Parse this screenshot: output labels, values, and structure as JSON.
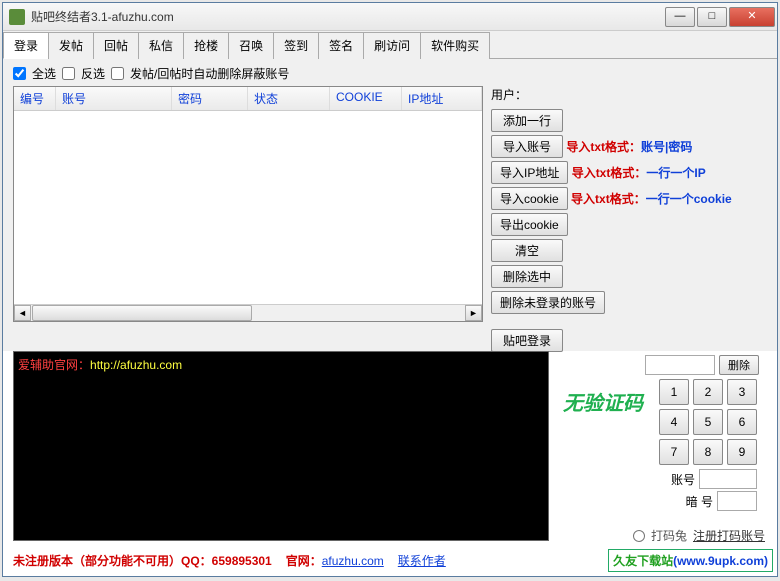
{
  "window": {
    "title": "贴吧终结者3.1-afuzhu.com",
    "min": "—",
    "max": "□",
    "close": "✕"
  },
  "tabs": [
    "登录",
    "发帖",
    "回帖",
    "私信",
    "抢楼",
    "召唤",
    "签到",
    "签名",
    "刷访问",
    "软件购买"
  ],
  "checkboxes": {
    "select_all": "全选",
    "invert": "反选",
    "auto_delete": "发帖/回帖时自动删除屏蔽账号"
  },
  "table": {
    "headers": [
      "编号",
      "账号",
      "密码",
      "状态",
      "COOKIE",
      "IP地址"
    ]
  },
  "side": {
    "user_label": "用户：",
    "add_row": "添加一行",
    "import_acct": "导入账号",
    "import_ip": "导入IP地址",
    "import_cookie": "导入cookie",
    "export_cookie": "导出cookie",
    "clear": "清空",
    "delete_selected": "删除选中",
    "delete_unlogged": "删除未登录的账号",
    "tieba_login": "贴吧登录",
    "hint_acct_a": "导入txt格式：",
    "hint_acct_b": "账号|密码",
    "hint_ip_a": "导入txt格式：",
    "hint_ip_b": "一行一个IP",
    "hint_cookie_a": "导入txt格式：",
    "hint_cookie_b": "一行一个cookie"
  },
  "console": {
    "label": "爱辅助官网：",
    "url": "http://afuzhu.com"
  },
  "right": {
    "noverify": "无验证码",
    "delete": "删除",
    "acct_label": "账号",
    "pwd_label": "暗 号",
    "numpad": [
      "1",
      "2",
      "3",
      "4",
      "5",
      "6",
      "7",
      "8",
      "9"
    ],
    "radio_dama": "打码兔",
    "radio_reg": "注册打码账号"
  },
  "footer": {
    "unreg": "未注册版本（部分功能不可用）QQ：659895301",
    "site_label": "官网：",
    "site": "afuzhu.com",
    "contact": "联系作者"
  },
  "watermark": {
    "a": "久友下载站",
    "b": "(www.9upk.com)"
  }
}
